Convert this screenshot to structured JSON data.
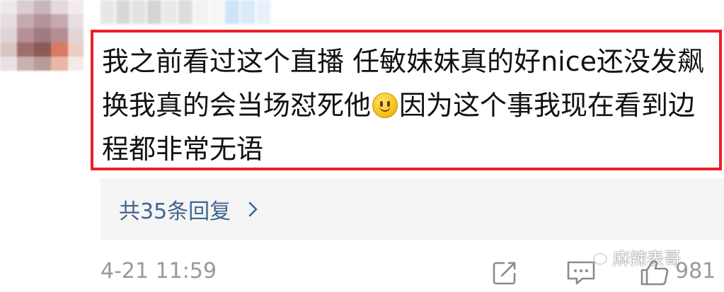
{
  "comment": {
    "text_before_emoji": "我之前看过这个直播 任敏妹妹真的好nice还没发飙 换我真的会当场怼死他",
    "emoji_icon": "smile-emoji",
    "text_after_emoji": "因为这个事我现在看到边程都非常无语"
  },
  "replies": {
    "label": "共35条回复",
    "icon": "chevron-right-icon"
  },
  "footer": {
    "timestamp": "4-21 11:59",
    "watermark": "麻辣表哥",
    "like_count": "981"
  },
  "colors": {
    "highlight_border": "#e8202c",
    "reply_link": "#41658f",
    "meta_text": "#999999",
    "reply_bg": "#f5f5f5"
  }
}
